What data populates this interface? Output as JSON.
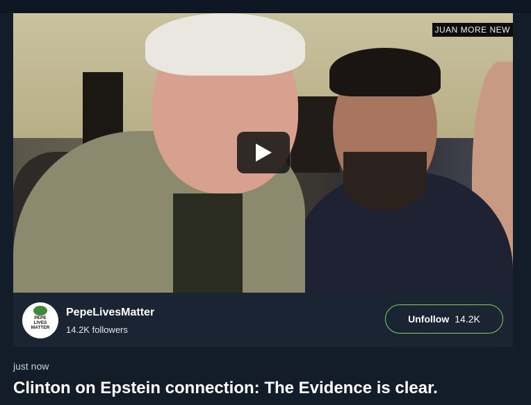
{
  "video": {
    "watermark": "JUAN MORE NEW",
    "play_icon": "play-icon"
  },
  "channel": {
    "avatar_text": "PEPE LIVES MATTER",
    "name": "PepeLivesMatter",
    "followers": "14.2K followers",
    "follow_button": {
      "label": "Unfollow",
      "count": "14.2K"
    },
    "accent_color": "#7fd35a"
  },
  "post": {
    "timestamp": "just now",
    "title": "Clinton on Epstein connection: The Evidence is clear."
  }
}
